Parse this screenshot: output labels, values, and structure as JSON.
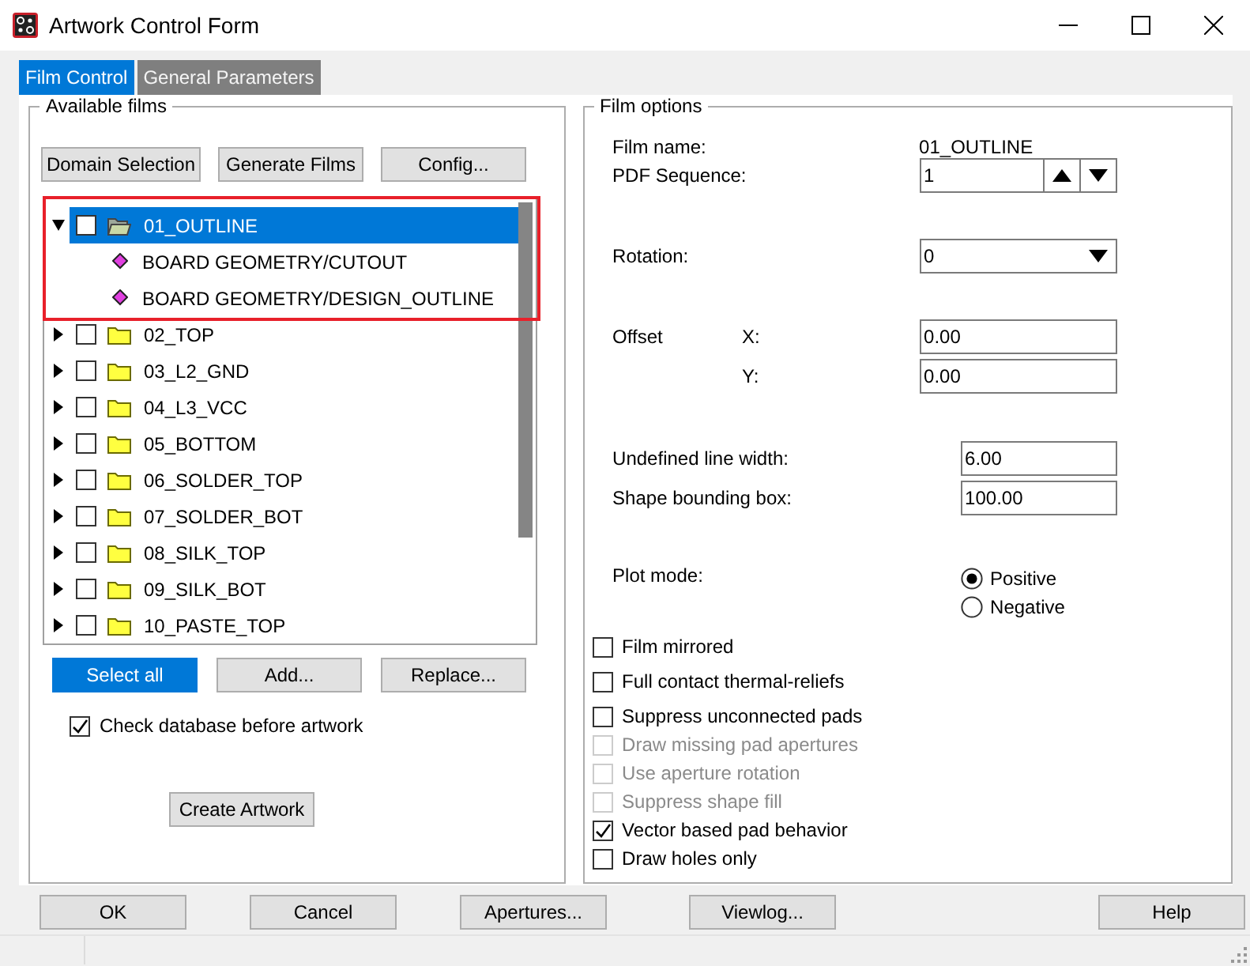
{
  "window": {
    "title": "Artwork Control Form"
  },
  "tabs": [
    {
      "label": "Film Control",
      "selected": true
    },
    {
      "label": "General Parameters",
      "selected": false
    }
  ],
  "available_films": {
    "title": "Available films",
    "top_buttons": [
      "Domain Selection",
      "Generate Films",
      "Config..."
    ],
    "tree": [
      {
        "label": "01_OUTLINE",
        "expanded": true,
        "checked": false,
        "selected": true,
        "highlighted": true,
        "children": [
          {
            "label": "BOARD GEOMETRY/CUTOUT"
          },
          {
            "label": "BOARD GEOMETRY/DESIGN_OUTLINE"
          }
        ]
      },
      {
        "label": "02_TOP",
        "expanded": false,
        "checked": false,
        "selected": false,
        "highlighted": false
      },
      {
        "label": "03_L2_GND",
        "expanded": false,
        "checked": false,
        "selected": false,
        "highlighted": false
      },
      {
        "label": "04_L3_VCC",
        "expanded": false,
        "checked": false,
        "selected": false,
        "highlighted": false
      },
      {
        "label": "05_BOTTOM",
        "expanded": false,
        "checked": false,
        "selected": false,
        "highlighted": false
      },
      {
        "label": "06_SOLDER_TOP",
        "expanded": false,
        "checked": false,
        "selected": false,
        "highlighted": false
      },
      {
        "label": "07_SOLDER_BOT",
        "expanded": false,
        "checked": false,
        "selected": false,
        "highlighted": false
      },
      {
        "label": "08_SILK_TOP",
        "expanded": false,
        "checked": false,
        "selected": false,
        "highlighted": false
      },
      {
        "label": "09_SILK_BOT",
        "expanded": false,
        "checked": false,
        "selected": false,
        "highlighted": false
      },
      {
        "label": "10_PASTE_TOP",
        "expanded": false,
        "checked": false,
        "selected": false,
        "highlighted": false
      }
    ],
    "action_buttons": [
      {
        "label": "Select all",
        "focused": true
      },
      {
        "label": "Add...",
        "focused": false
      },
      {
        "label": "Replace...",
        "focused": false
      }
    ],
    "check_database": {
      "label": "Check database before artwork",
      "checked": true
    },
    "create_button": "Create Artwork"
  },
  "film_options": {
    "title": "Film options",
    "film_name": {
      "label": "Film name:",
      "value": "01_OUTLINE"
    },
    "pdf_sequence": {
      "label": "PDF Sequence:",
      "value": "1"
    },
    "rotation": {
      "label": "Rotation:",
      "value": "0"
    },
    "offset": {
      "label": "Offset",
      "x_label": "X:",
      "x_value": "0.00",
      "y_label": "Y:",
      "y_value": "0.00"
    },
    "undefined_line_width": {
      "label": "Undefined line width:",
      "value": "6.00"
    },
    "shape_bounding_box": {
      "label": "Shape bounding box:",
      "value": "100.00"
    },
    "plot_mode": {
      "label": "Plot mode:",
      "options": [
        {
          "label": "Positive",
          "selected": true
        },
        {
          "label": "Negative",
          "selected": false
        }
      ]
    },
    "checkboxes": [
      {
        "label": "Film mirrored",
        "checked": false,
        "disabled": false
      },
      {
        "label": "Full contact thermal-reliefs",
        "checked": false,
        "disabled": false
      },
      {
        "label": "Suppress unconnected pads",
        "checked": false,
        "disabled": false
      },
      {
        "label": "Draw missing pad apertures",
        "checked": false,
        "disabled": true
      },
      {
        "label": "Use aperture rotation",
        "checked": false,
        "disabled": true
      },
      {
        "label": "Suppress shape fill",
        "checked": false,
        "disabled": true
      },
      {
        "label": "Vector based pad behavior",
        "checked": true,
        "disabled": false
      },
      {
        "label": "Draw holes only",
        "checked": false,
        "disabled": false
      }
    ]
  },
  "footer_buttons": [
    "OK",
    "Cancel",
    "Apertures...",
    "Viewlog...",
    "Help"
  ]
}
